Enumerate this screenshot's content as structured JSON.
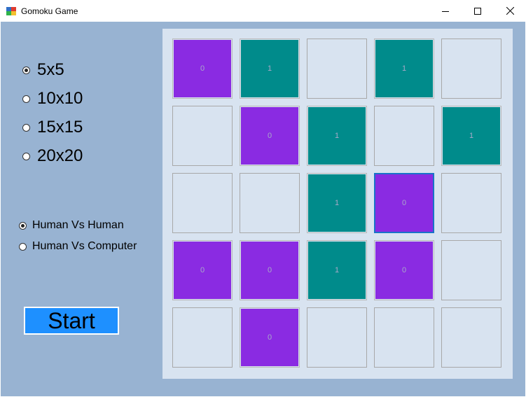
{
  "window": {
    "title": "Gomoku Game",
    "icons": {
      "app": "gomoku-app-icon",
      "minimize": "minimize-icon",
      "maximize": "maximize-icon",
      "close": "close-icon"
    }
  },
  "colors": {
    "client_bg": "#98b3d2",
    "board_bg": "#d8e3f0",
    "player0": "#8a2be2",
    "player1": "#008b8b",
    "start_bg": "#1e90ff",
    "selected_border": "#1a73c8"
  },
  "board_sizes": [
    {
      "label": "5x5",
      "checked": true
    },
    {
      "label": "10x10",
      "checked": false
    },
    {
      "label": "15x15",
      "checked": false
    },
    {
      "label": "20x20",
      "checked": false
    }
  ],
  "modes": [
    {
      "label": "Human Vs Human",
      "checked": true
    },
    {
      "label": "Human Vs Computer",
      "checked": false
    }
  ],
  "start_label": "Start",
  "board": {
    "rows": 5,
    "cols": 5,
    "cells": [
      [
        "0",
        "1",
        "",
        "1",
        ""
      ],
      [
        "",
        "0",
        "1",
        "",
        "1"
      ],
      [
        "",
        "",
        "1",
        "0",
        ""
      ],
      [
        "0",
        "0",
        "1",
        "0",
        ""
      ],
      [
        "",
        "0",
        "",
        "",
        ""
      ]
    ],
    "selected": {
      "row": 2,
      "col": 3
    }
  }
}
